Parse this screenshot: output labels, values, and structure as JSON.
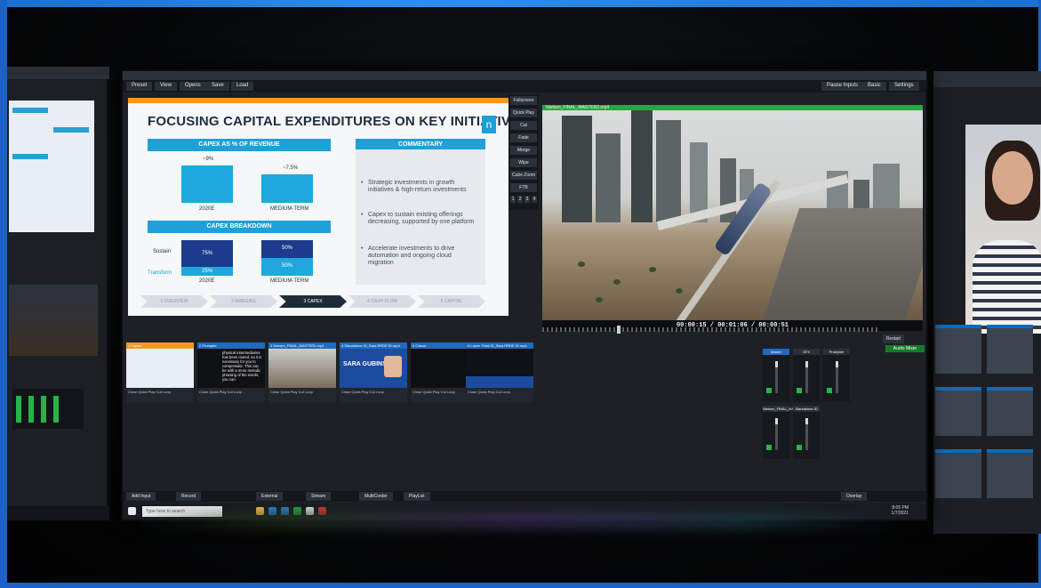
{
  "main_window": {
    "menu": [
      "Preset",
      "View",
      "Opens",
      "Save",
      "Load"
    ],
    "right_menu": [
      "Pause Inputs",
      "Basic",
      "Settings",
      "?"
    ]
  },
  "slide": {
    "title": "FOCUSING CAPITAL EXPENDITURES ON KEY INITIATIVES",
    "logo": "n",
    "capex_header": "CAPEX AS % OF REVENUE",
    "capex_bars": [
      {
        "label": "2020E",
        "value_label": "~9%"
      },
      {
        "label": "MEDIUM-TERM",
        "value_label": "~7.5%"
      }
    ],
    "breakdown_header": "CAPEX BREAKDOWN",
    "breakdown_legend": [
      "Sustain",
      "Transform"
    ],
    "breakdown_bars": [
      {
        "label": "2020E",
        "sustain": "75%",
        "transform": "25%"
      },
      {
        "label": "MEDIUM-TERM",
        "sustain": "50%",
        "transform": "50%"
      }
    ],
    "commentary_header": "COMMENTARY",
    "commentary": [
      "Strategic investments in growth initiatives & high-return investments",
      "Capex to sustain existing offerings decreasing, supported by one platform",
      "Accelerate investments to drive automation and ongoing cloud migration"
    ],
    "steps": [
      "1 OVERVIEW",
      "2 MARGINS",
      "3 CAPEX",
      "4 CASH FLOW",
      "5 CAPITAL"
    ],
    "active_step": 2
  },
  "transitions": {
    "buttons": [
      "Fullscreen",
      "Quick Play",
      "Cut",
      "Fade",
      "Merge",
      "Wipe",
      "Cube Zoom",
      "FTB"
    ],
    "numbers": [
      "1",
      "2",
      "3",
      "4"
    ]
  },
  "program": {
    "label": "Nielsen_FINAL_MASTER2.mp4",
    "timecode": "00:00:15 / 00:01:06 / 00:00:51",
    "restart": "Restart",
    "audio_mixer": "Audio Mixer"
  },
  "inputs": [
    {
      "number": "1",
      "name": "Capex",
      "color": "#f39a1c",
      "controls": "Close Quick Play Cut Loop"
    },
    {
      "number": "2",
      "name": "Prompter",
      "color": "#1f6bbd",
      "controls": "Close Quick Play Cut Loop",
      "text": "physical intermediaries has been muted, so it is necessary for you to compensate. This can be with a more melodic phrasing of the words; you can"
    },
    {
      "number": "3",
      "name": "Nielsen_FINAL_MASTER2.mp4",
      "color": "#1f6bbd",
      "controls": "Close Quick Play Cut Loop"
    },
    {
      "number": "4",
      "name": "Standalone ID_Sara RRDE ID.mp4",
      "color": "#1f6bbd",
      "controls": "Close Quick Play Cut Loop",
      "profile_name": "SARA GUBINS"
    },
    {
      "number": "5",
      "name": "Colour",
      "color": "#1f6bbd",
      "controls": "Close Quick Play Cut Loop"
    },
    {
      "number": "6",
      "name": "Lower Third ID_Sara RRDE ID.mp4",
      "color": "#1f6bbd",
      "controls": "Close Quick Play Cut Loop"
    }
  ],
  "mixer": {
    "channels": [
      "Master",
      "GFX",
      "Prompter",
      "Nielsen_FINAL_MA...",
      "Standalone ID"
    ]
  },
  "bottom_bar": [
    "Add Input",
    "Record",
    "External",
    "Stream",
    "MultiCorder",
    "PlayList"
  ],
  "status_right": "Overlay",
  "taskbar": {
    "search_placeholder": "Type here to search",
    "time": "8:05 PM",
    "date": "1/7/2021"
  },
  "colors": {
    "accent_blue": "#1fa0d8",
    "program_green": "#29a544",
    "preview_orange": "#f39a1c"
  }
}
